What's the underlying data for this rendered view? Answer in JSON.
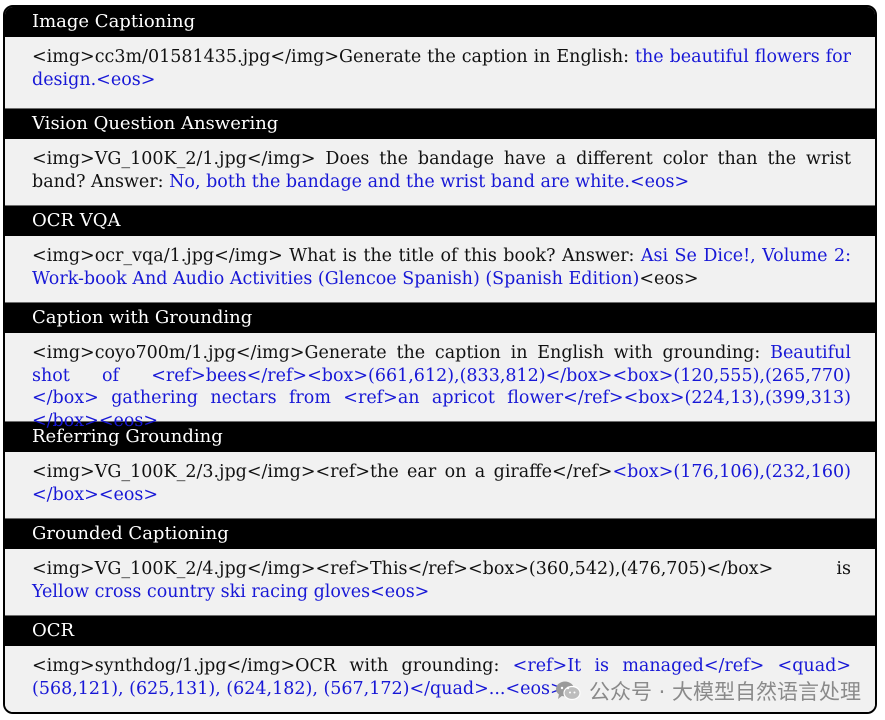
{
  "sections": [
    {
      "title": "Image Captioning",
      "prompt": "<img>cc3m/01581435.jpg</img>Generate the caption in English: ",
      "answer": "the beautiful flowers for design.<eos>",
      "suffix": ""
    },
    {
      "title": "Vision Question Answering",
      "prompt": "<img>VG_100K_2/1.jpg</img> Does the bandage have a different color than the wrist band? Answer: ",
      "answer": "No, both the bandage and the wrist band are white.<eos>",
      "suffix": ""
    },
    {
      "title": "OCR VQA",
      "prompt": "<img>ocr_vqa/1.jpg</img> What is the title of this book? Answer: ",
      "answer": "Asi Se Dice!, Volume 2: Work-book And Audio Activities (Glencoe Spanish) (Spanish Edition)",
      "suffix": "<eos>"
    },
    {
      "title": "Caption with Grounding",
      "prompt": "<img>coyo700m/1.jpg</img>Generate the caption in English with grounding: ",
      "answer": "Beautiful shot of <ref>bees</ref><box>(661,612),(833,812)</box><box>(120,555),(265,770) </box> gathering nectars from <ref>an apricot flower</ref><box>(224,13),(399,313) </box><eos>",
      "suffix": ""
    },
    {
      "title": "Referring Grounding",
      "prompt": "<img>VG_100K_2/3.jpg</img><ref>the ear on a giraffe</ref>",
      "answer": "<box>(176,106),(232,160) </box><eos>",
      "suffix": ""
    },
    {
      "title": "Grounded Captioning",
      "prompt": "<img>VG_100K_2/4.jpg</img><ref>This</ref><box>(360,542),(476,705)</box> is ",
      "answer": "Yellow cross country ski racing gloves<eos>",
      "suffix": ""
    },
    {
      "title": "OCR",
      "prompt": "<img>synthdog/1.jpg</img>OCR with grounding: ",
      "answer": "<ref>It is managed</ref> <quad> (568,121), (625,131), (624,182), (567,172)</quad>...<eos>",
      "suffix": ""
    }
  ],
  "watermark": {
    "text": "公众号 · 大模型自然语言处理",
    "icon": "wechat-icon"
  },
  "colors": {
    "header_bg": "#000000",
    "header_text": "#ffffff",
    "body_bg": "#f1f1f1",
    "answer_blue": "#1717d6"
  }
}
